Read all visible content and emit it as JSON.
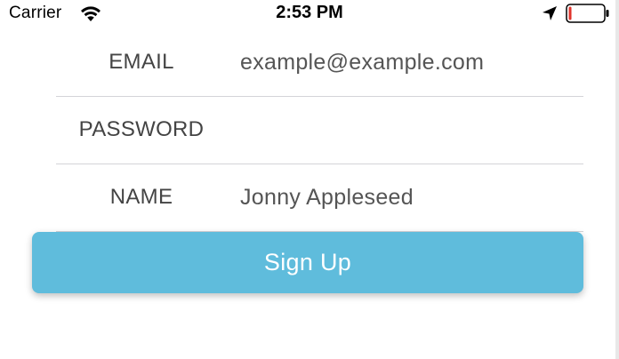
{
  "status_bar": {
    "carrier": "Carrier",
    "time": "2:53 PM",
    "icons": {
      "wifi": "wifi-icon",
      "location": "location-arrow-icon",
      "battery": "battery-low-icon"
    },
    "battery_level": 0.08,
    "battery_color": "#e0342c"
  },
  "form": {
    "email": {
      "label": "EMAIL",
      "value": "example@example.com"
    },
    "password": {
      "label": "PASSWORD",
      "value": ""
    },
    "name": {
      "label": "NAME",
      "value": "Jonny Appleseed"
    }
  },
  "signup_button": {
    "label": "Sign Up",
    "color": "#5fbcdc"
  }
}
